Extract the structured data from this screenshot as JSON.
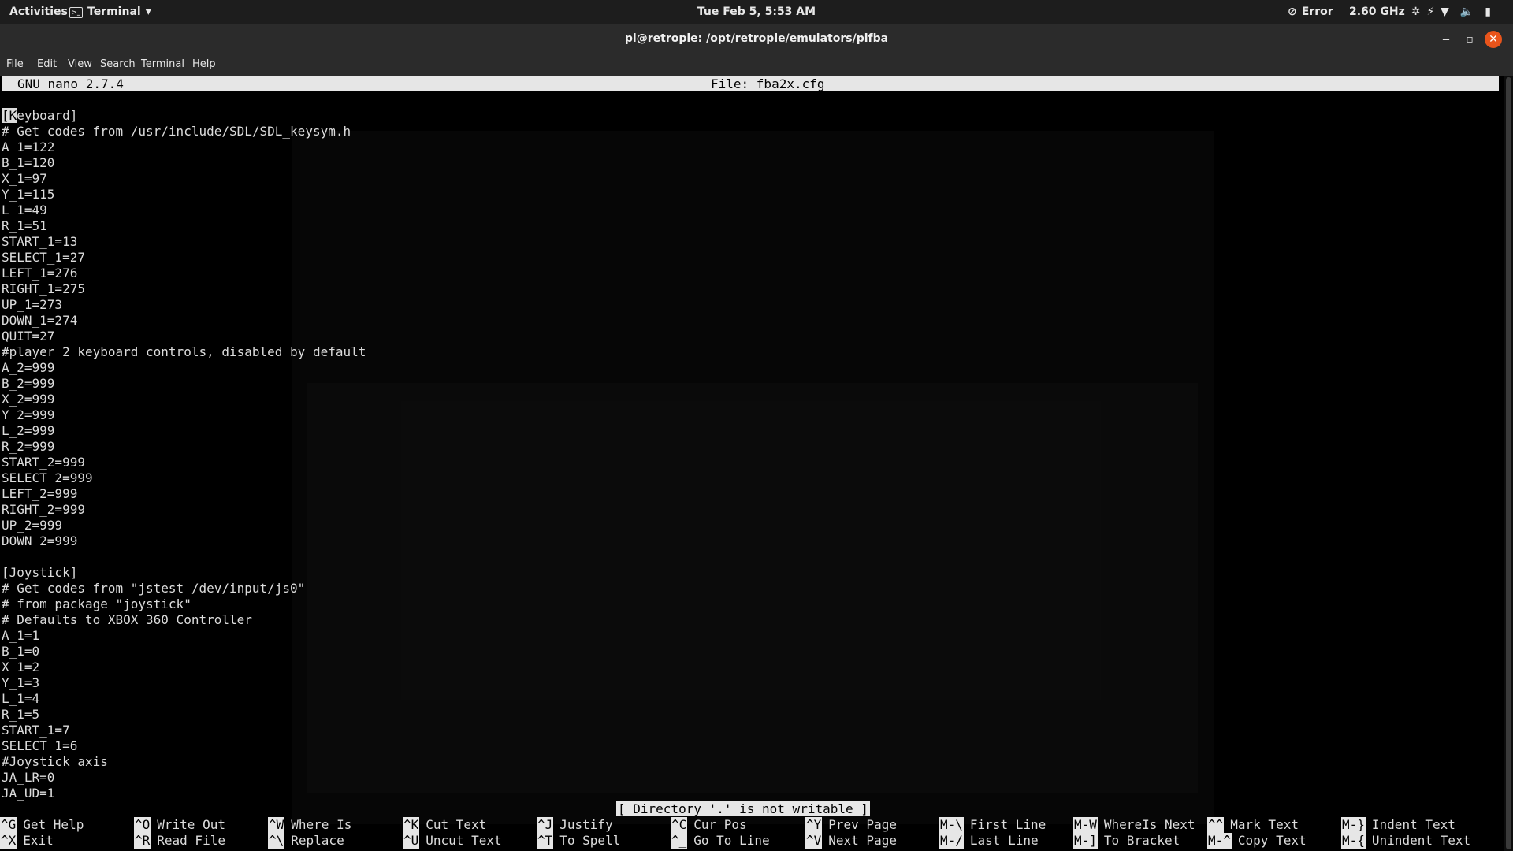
{
  "topbar": {
    "activities": "Activities",
    "app_name": "Terminal",
    "clock": "Tue Feb 5,  5:53 AM",
    "error_label": "Error",
    "cpu_freq": "2.60 GHz"
  },
  "window": {
    "title": "pi@retropie: /opt/retropie/emulators/pifba"
  },
  "menu": [
    "File",
    "Edit",
    "View",
    "Search",
    "Terminal",
    "Help"
  ],
  "nano": {
    "version": "GNU nano 2.7.4",
    "file": "File: fba2x.cfg",
    "status": "[ Directory '.' is not writable ]",
    "lines": [
      "[Keyboard]",
      "# Get codes from /usr/include/SDL/SDL_keysym.h",
      "A_1=122",
      "B_1=120",
      "X_1=97",
      "Y_1=115",
      "L_1=49",
      "R_1=51",
      "START_1=13",
      "SELECT_1=27",
      "LEFT_1=276",
      "RIGHT_1=275",
      "UP_1=273",
      "DOWN_1=274",
      "QUIT=27",
      "#player 2 keyboard controls, disabled by default",
      "A_2=999",
      "B_2=999",
      "X_2=999",
      "Y_2=999",
      "L_2=999",
      "R_2=999",
      "START_2=999",
      "SELECT_2=999",
      "LEFT_2=999",
      "RIGHT_2=999",
      "UP_2=999",
      "DOWN_2=999",
      "",
      "[Joystick]",
      "# Get codes from \"jstest /dev/input/js0\"",
      "# from package \"joystick\"",
      "# Defaults to XBOX 360 Controller",
      "A_1=1",
      "B_1=0",
      "X_1=2",
      "Y_1=3",
      "L_1=4",
      "R_1=5",
      "START_1=7",
      "SELECT_1=6",
      "#Joystick axis",
      "JA_LR=0",
      "JA_UD=1"
    ],
    "shortcuts_row1": [
      {
        "key": "^G",
        "label": "Get Help"
      },
      {
        "key": "^O",
        "label": "Write Out"
      },
      {
        "key": "^W",
        "label": "Where Is"
      },
      {
        "key": "^K",
        "label": "Cut Text"
      },
      {
        "key": "^J",
        "label": "Justify"
      },
      {
        "key": "^C",
        "label": "Cur Pos"
      },
      {
        "key": "^Y",
        "label": "Prev Page"
      },
      {
        "key": "M-\\",
        "label": "First Line"
      },
      {
        "key": "M-W",
        "label": "WhereIs Next"
      },
      {
        "key": "^^",
        "label": "Mark Text"
      },
      {
        "key": "M-}",
        "label": "Indent Text"
      }
    ],
    "shortcuts_row2": [
      {
        "key": "^X",
        "label": "Exit"
      },
      {
        "key": "^R",
        "label": "Read File"
      },
      {
        "key": "^\\",
        "label": "Replace"
      },
      {
        "key": "^U",
        "label": "Uncut Text"
      },
      {
        "key": "^T",
        "label": "To Spell"
      },
      {
        "key": "^_",
        "label": "Go To Line"
      },
      {
        "key": "^V",
        "label": "Next Page"
      },
      {
        "key": "M-/",
        "label": "Last Line"
      },
      {
        "key": "M-]",
        "label": "To Bracket"
      },
      {
        "key": "M-^",
        "label": "Copy Text"
      },
      {
        "key": "M-{",
        "label": "Unindent Text"
      }
    ]
  }
}
